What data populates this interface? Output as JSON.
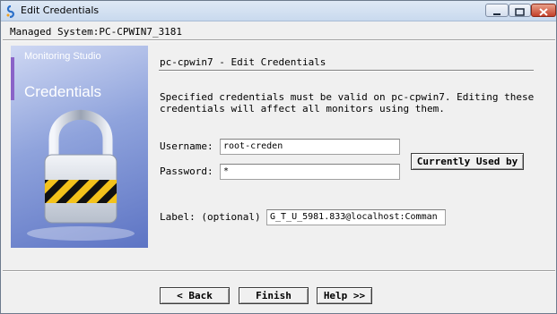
{
  "window": {
    "title": "Edit Credentials"
  },
  "header": {
    "managed_system": "Managed System:PC-CPWIN7_3181"
  },
  "banner": {
    "line1": "Monitoring Studio",
    "line2": "Credentials"
  },
  "main": {
    "title": "pc-cpwin7 - Edit Credentials",
    "description": "Specified credentials must be valid on pc-cpwin7. Editing these credentials will affect all monitors using them."
  },
  "form": {
    "username_label": "Username:",
    "username_value": "root-creden",
    "password_label": "Password:",
    "password_value": "*",
    "currently_used_by_label": "Currently Used by",
    "label_label": "Label: (optional)",
    "label_value": "G_T_U_5981.833@localhost:Comman"
  },
  "footer": {
    "back_label": "< Back",
    "finish_label": "Finish",
    "help_label": "Help >>"
  }
}
